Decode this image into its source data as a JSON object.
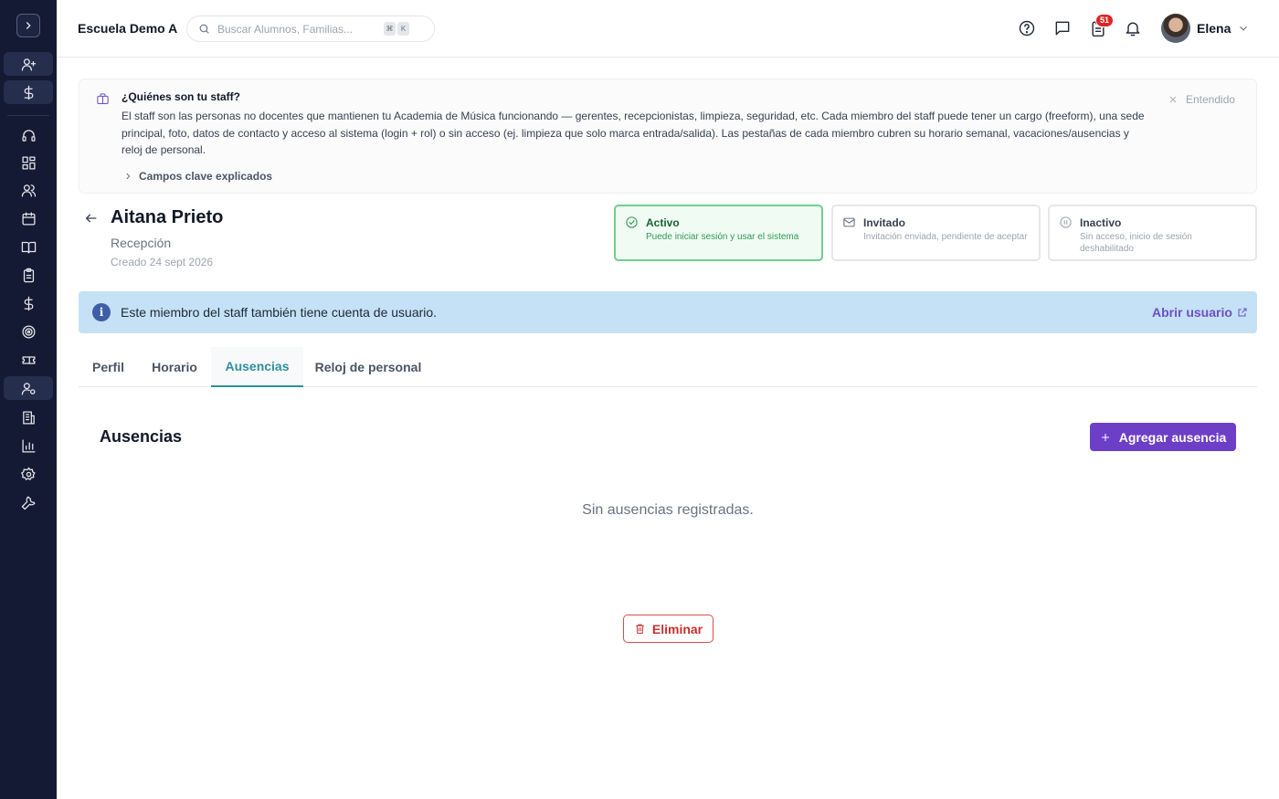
{
  "app": {
    "school_name": "Escuela Demo A",
    "search_placeholder": "Buscar Alumnos, Familias...",
    "search_shortcut": [
      "⌘",
      "K"
    ],
    "notification_count": "51",
    "user_name": "Elena"
  },
  "sidebar": {
    "icons": [
      "chevron-right-icon",
      "user-plus-icon",
      "dollar-icon",
      "headset-icon",
      "grid-icon",
      "users-icon",
      "calendar-icon",
      "book-icon",
      "clipboard-icon",
      "dollar-icon",
      "target-icon",
      "ticket-icon",
      "user-cog-icon",
      "building-icon",
      "bar-chart-icon",
      "gear-icon",
      "wrench-icon"
    ]
  },
  "info_card": {
    "title": "¿Quiénes son tu staff?",
    "body": "El staff son las personas no docentes que mantienen tu Academia de Música funcionando — gerentes, recepcionistas, limpieza, seguridad, etc. Cada miembro del staff puede tener un cargo (freeform), una sede principal, foto, datos de contacto y acceso al sistema (login + rol) o sin acceso (ej. limpieza que solo marca entrada/salida). Las pestañas de cada miembro cubren su horario semanal, vacaciones/ausencias y reloj de personal.",
    "more_label": "Campos clave explicados",
    "dismiss_label": "Entendido"
  },
  "staff": {
    "name": "Aitana Prieto",
    "role": "Recepción",
    "created": "Creado 24 sept 2026"
  },
  "statuses": [
    {
      "title": "Activo",
      "desc": "Puede iniciar sesión y usar el sistema",
      "selected": true
    },
    {
      "title": "Invitado",
      "desc": "Invitación enviada, pendiente de aceptar",
      "selected": false
    },
    {
      "title": "Inactivo",
      "desc": "Sin acceso, inicio de sesión deshabilitado",
      "selected": false
    }
  ],
  "user_banner": {
    "text": "Este miembro del staff también tiene cuenta de usuario.",
    "link": "Abrir usuario"
  },
  "tabs": [
    {
      "label": "Perfil"
    },
    {
      "label": "Horario"
    },
    {
      "label": "Ausencias",
      "active": true
    },
    {
      "label": "Reloj de personal"
    }
  ],
  "absences": {
    "title": "Ausencias",
    "add_label": "Agregar ausencia",
    "empty_text": "Sin ausencias registradas."
  },
  "delete_label": "Eliminar",
  "colors": {
    "sidebar_bg": "#141a33",
    "accent_purple": "#6d3fc7",
    "active_green": "#6fcf8a",
    "tab_active": "#2f8f9d",
    "banner_blue": "#c5e1f6",
    "danger": "#c53030"
  }
}
